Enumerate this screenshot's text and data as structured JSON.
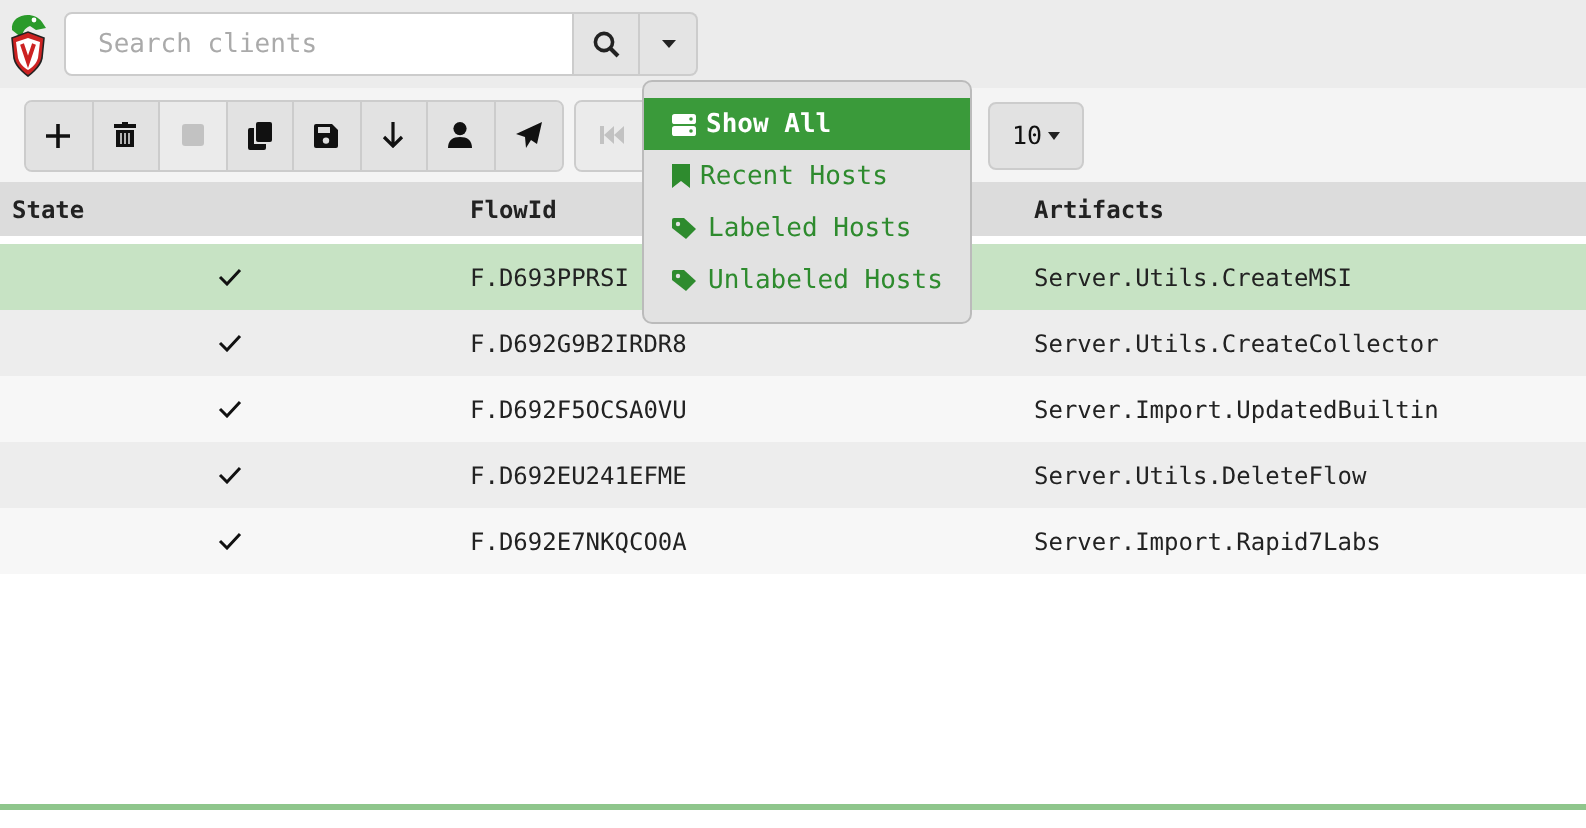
{
  "search": {
    "placeholder": "Search clients"
  },
  "toolbar": {
    "buttons": [
      {
        "disabled": false
      },
      {
        "disabled": false
      },
      {
        "disabled": true
      },
      {
        "disabled": false
      },
      {
        "disabled": false
      },
      {
        "disabled": false
      },
      {
        "disabled": false
      },
      {
        "disabled": false
      }
    ],
    "pagination": {
      "first_disabled": true,
      "page_size": "10"
    }
  },
  "dropdown": {
    "items": [
      {
        "label": "Show All",
        "selected": true
      },
      {
        "label": "Recent Hosts",
        "selected": false
      },
      {
        "label": "Labeled Hosts",
        "selected": false
      },
      {
        "label": "Unlabeled Hosts",
        "selected": false
      }
    ]
  },
  "table": {
    "columns": [
      "State",
      "FlowId",
      "Artifacts"
    ],
    "rows": [
      {
        "flow_id": "F.D693PPRSI",
        "artifacts": "Server.Utils.CreateMSI",
        "selected": true
      },
      {
        "flow_id": "F.D692G9B2IRDR8",
        "artifacts": "Server.Utils.CreateCollector",
        "selected": false
      },
      {
        "flow_id": "F.D692F5OCSA0VU",
        "artifacts": "Server.Import.UpdatedBuiltin",
        "selected": false
      },
      {
        "flow_id": "F.D692EU241EFME",
        "artifacts": "Server.Utils.DeleteFlow",
        "selected": false
      },
      {
        "flow_id": "F.D692E7NKQCO0A",
        "artifacts": "Server.Import.Rapid7Labs",
        "selected": false
      }
    ]
  }
}
